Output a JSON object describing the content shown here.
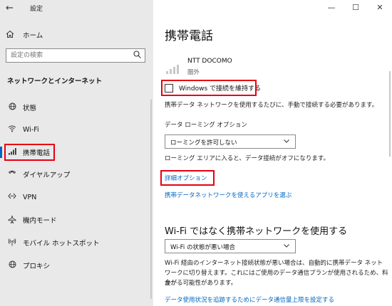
{
  "sidebar": {
    "back_icon": "←",
    "app_title": "設定",
    "home_label": "ホーム",
    "search_placeholder": "設定の検索",
    "section_title": "ネットワークとインターネット",
    "items": [
      {
        "label": "状態",
        "icon": "globe-icon"
      },
      {
        "label": "Wi-Fi",
        "icon": "wifi-icon"
      },
      {
        "label": "携帯電話",
        "icon": "cellular-icon",
        "active": true
      },
      {
        "label": "ダイヤルアップ",
        "icon": "phone-icon"
      },
      {
        "label": "VPN",
        "icon": "vpn-icon"
      },
      {
        "label": "機内モード",
        "icon": "airplane-icon"
      },
      {
        "label": "モバイル ホットスポット",
        "icon": "hotspot-icon"
      },
      {
        "label": "プロキシ",
        "icon": "globe-icon"
      }
    ]
  },
  "window": {
    "minimize": "—",
    "maximize": "☐",
    "close": "✕"
  },
  "main": {
    "title": "携帯電話",
    "carrier_name": "NTT DOCOMO",
    "carrier_status": "圏外",
    "keep_connected_label": "Windows で接続を維持する",
    "keep_connected_checked": false,
    "manual_connect_desc": "携帯データ ネットワークを使用するたびに、手動で接続する必要があります。",
    "roaming_label": "データ ローミング オプション",
    "roaming_value": "ローミングを許可しない",
    "roaming_desc": "ローミング エリアに入ると、データ接続がオフになります。",
    "advanced_link": "詳細オプション",
    "apps_link": "携帯データネットワークを使えるアプリを選ぶ",
    "wifi_pref_title": "Wi-Fi ではなく携帯ネットワークを使用する",
    "wifi_pref_value": "Wi-Fi の状態が悪い場合",
    "wifi_pref_desc_1": "Wi-Fi 経由のインターネット接続状態が悪い場合は、自動的に携帯データ ネット",
    "wifi_pref_desc_2": "ワークに切り替えます。これにはご使用のデータ通信プランが使用されるため、料金が",
    "wifi_pref_desc_3": "かかる可能性があります。",
    "data_limit_link": "データ使用状況を追跡するためにデータ通信量上限を設定する"
  },
  "colors": {
    "accent": "#0067c0",
    "highlight_box": "#e60012",
    "sidebar_bg": "#e9e9e9"
  }
}
